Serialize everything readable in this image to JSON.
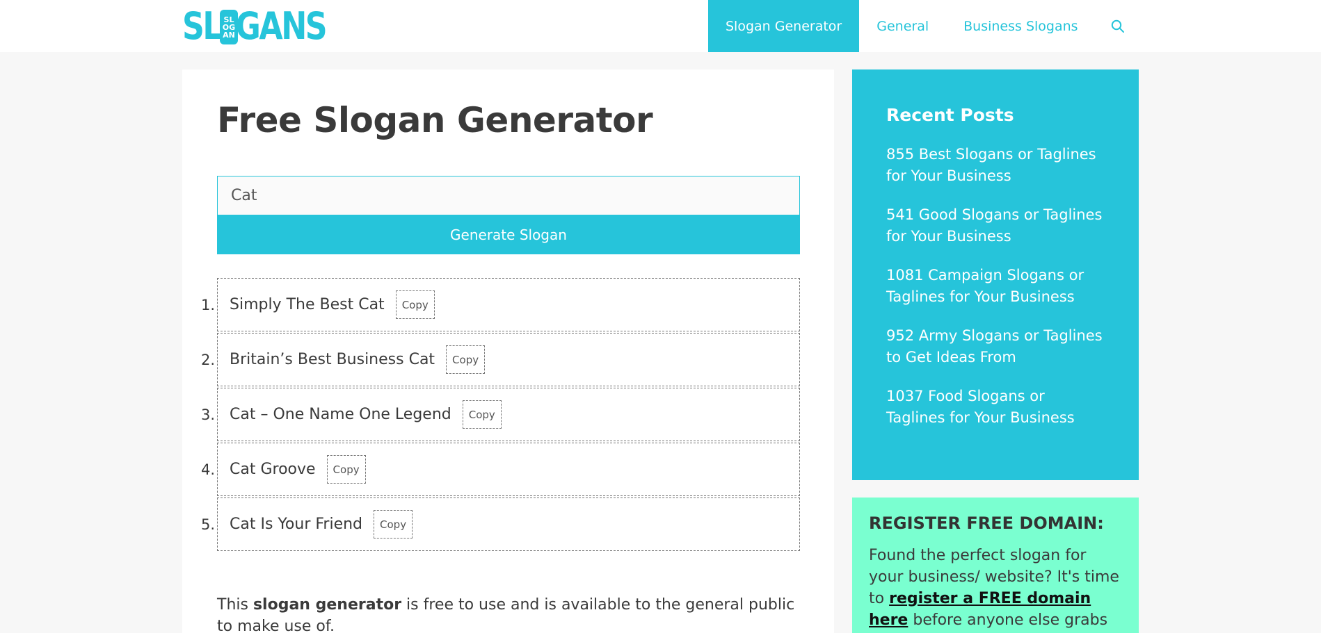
{
  "brand": {
    "logo_left": "SL",
    "logo_right": "GANS",
    "logo_pill": [
      "SL",
      "OG",
      "AN"
    ],
    "accent": "#26c4da",
    "domain_bg": "#7affd0"
  },
  "nav": {
    "items": [
      {
        "label": "Slogan Generator",
        "active": true
      },
      {
        "label": "General",
        "active": false
      },
      {
        "label": "Business Slogans",
        "active": false
      }
    ],
    "search_icon": "search-icon"
  },
  "main": {
    "title": "Free Slogan Generator",
    "input_value": "Cat",
    "button_label": "Generate Slogan",
    "slogans": [
      {
        "num": "1.",
        "text": "Simply The Best Cat",
        "copy": "Copy"
      },
      {
        "num": "2.",
        "text": "Britain’s Best Business Cat",
        "copy": "Copy"
      },
      {
        "num": "3.",
        "text": "Cat – One Name One Legend",
        "copy": "Copy"
      },
      {
        "num": "4.",
        "text": "Cat Groove",
        "copy": "Copy"
      },
      {
        "num": "5.",
        "text": "Cat Is Your Friend",
        "copy": "Copy"
      }
    ],
    "intro_before": "This ",
    "intro_bold": "slogan generator",
    "intro_after": " is free to use and is available to the general public to make use of."
  },
  "sidebar": {
    "recent_title": "Recent Posts",
    "posts": [
      "855 Best Slogans or Taglines for Your Business",
      "541 Good Slogans or Taglines for Your Business",
      "1081 Campaign Slogans or Taglines for Your Business",
      "952 Army Slogans or Taglines to Get Ideas From",
      "1037 Food Slogans or Taglines for Your Business"
    ],
    "domain_title": "REGISTER FREE DOMAIN:",
    "domain_text_before": "Found the perfect slogan for your business/ website? It's time to ",
    "domain_link": "register a FREE domain here",
    "domain_text_after": " before anyone else grabs it."
  }
}
